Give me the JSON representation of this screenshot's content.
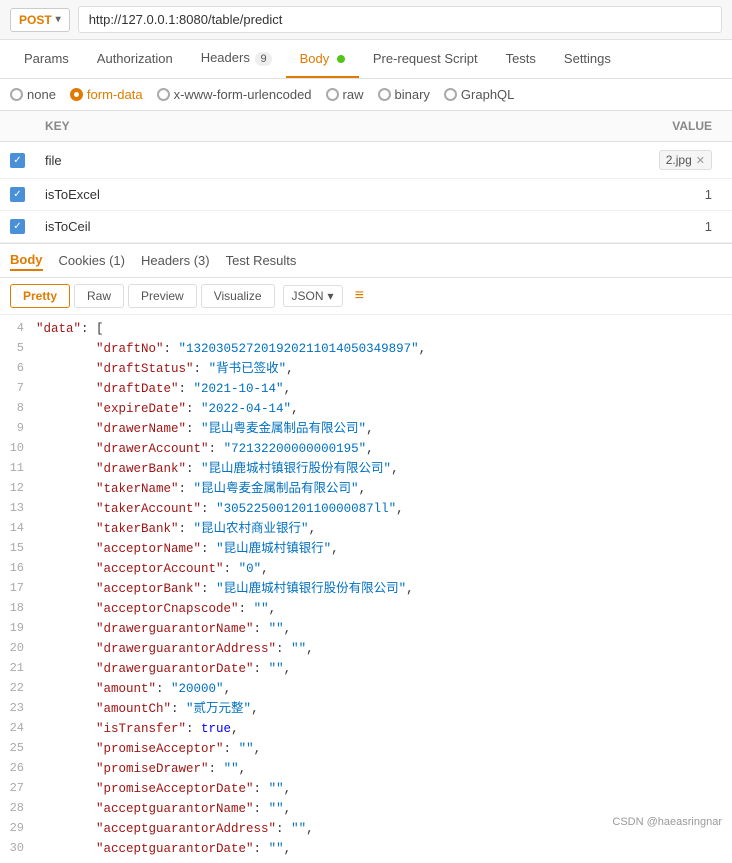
{
  "topbar": {
    "method": "POST",
    "url": "http://127.0.0.1:8080/table/predict"
  },
  "navtabs": {
    "items": [
      {
        "label": "Params",
        "active": false
      },
      {
        "label": "Authorization",
        "active": false
      },
      {
        "label": "Headers",
        "badge": "9",
        "active": false,
        "dot": false
      },
      {
        "label": "Body",
        "active": true,
        "dot": true
      },
      {
        "label": "Pre-request Script",
        "active": false
      },
      {
        "label": "Tests",
        "active": false
      },
      {
        "label": "Settings",
        "active": false
      }
    ]
  },
  "bodytypes": [
    {
      "label": "none",
      "selected": false
    },
    {
      "label": "form-data",
      "selected": true,
      "color": "#e07b00"
    },
    {
      "label": "x-www-form-urlencoded",
      "selected": false
    },
    {
      "label": "raw",
      "selected": false
    },
    {
      "label": "binary",
      "selected": false
    },
    {
      "label": "GraphQL",
      "selected": false
    }
  ],
  "table": {
    "columns": [
      "KEY",
      "VALUE"
    ],
    "rows": [
      {
        "checked": true,
        "key": "file",
        "value": "2.jpg",
        "isFile": true
      },
      {
        "checked": true,
        "key": "isToExcel",
        "value": "1",
        "isFile": false
      },
      {
        "checked": true,
        "key": "isToCeil",
        "value": "1",
        "isFile": false
      }
    ]
  },
  "responsetabs": [
    {
      "label": "Body",
      "active": true
    },
    {
      "label": "Cookies (1)",
      "active": false
    },
    {
      "label": "Headers (3)",
      "active": false
    },
    {
      "label": "Test Results",
      "active": false
    }
  ],
  "formattabs": [
    {
      "label": "Pretty",
      "active": true
    },
    {
      "label": "Raw",
      "active": false
    },
    {
      "label": "Preview",
      "active": false
    },
    {
      "label": "Visualize",
      "active": false
    }
  ],
  "jsonformat": "JSON",
  "codelines": [
    {
      "num": 4,
      "content": "    \"data\": [",
      "type": "mixed",
      "key": "data",
      "after": "["
    },
    {
      "num": 5,
      "content": "        \"draftNo\": \"132030527201920211014050349897\",",
      "key": "draftNo",
      "val": "132030527201920211014050349897"
    },
    {
      "num": 6,
      "content": "        \"draftStatus\": \"背书已签收\",",
      "key": "draftStatus",
      "val": "背书已签收"
    },
    {
      "num": 7,
      "content": "        \"draftDate\": \"2021-10-14\",",
      "key": "draftDate",
      "val": "2021-10-14"
    },
    {
      "num": 8,
      "content": "        \"expireDate\": \"2022-04-14\",",
      "key": "expireDate",
      "val": "2022-04-14"
    },
    {
      "num": 9,
      "content": "        \"drawerName\": \"昆山粤麦金属制品有限公司\",",
      "key": "drawerName",
      "val": "昆山粤麦金属制品有限公司"
    },
    {
      "num": 10,
      "content": "        \"drawerAccount\": \"72132200000000195\",",
      "key": "drawerAccount",
      "val": "72132200000000195"
    },
    {
      "num": 11,
      "content": "        \"drawerBank\": \"昆山鹿城村镇银行股份有限公司\",",
      "key": "drawerBank",
      "val": "昆山鹿城村镇银行股份有限公司"
    },
    {
      "num": 12,
      "content": "        \"takerName\": \"昆山粤麦金属制品有限公司\",",
      "key": "takerName",
      "val": "昆山粤麦金属制品有限公司"
    },
    {
      "num": 13,
      "content": "        \"takerAccount\": \"30522500120110000087ll\",",
      "key": "takerAccount",
      "val": "30522500120110000087ll"
    },
    {
      "num": 14,
      "content": "        \"takerBank\": \"昆山农村商业银行\",",
      "key": "takerBank",
      "val": "昆山农村商业银行"
    },
    {
      "num": 15,
      "content": "        \"acceptorName\": \"昆山鹿城村镇银行\",",
      "key": "acceptorName",
      "val": "昆山鹿城村镇银行"
    },
    {
      "num": 16,
      "content": "        \"acceptorAccount\": \"0\",",
      "key": "acceptorAccount",
      "val": "0"
    },
    {
      "num": 17,
      "content": "        \"acceptorBank\": \"昆山鹿城村镇银行股份有限公司\",",
      "key": "acceptorBank",
      "val": "昆山鹿城村镇银行股份有限公司"
    },
    {
      "num": 18,
      "content": "        \"acceptorCnapscode\": \"\",",
      "key": "acceptorCnapscode",
      "val": ""
    },
    {
      "num": 19,
      "content": "        \"drawerguarantorName\": \"\",",
      "key": "drawerguarantorName",
      "val": ""
    },
    {
      "num": 20,
      "content": "        \"drawerguarantorAddress\": \"\",",
      "key": "drawerguarantorAddress",
      "val": ""
    },
    {
      "num": 21,
      "content": "        \"drawerguarantorDate\": \"\",",
      "key": "drawerguarantorDate",
      "val": ""
    },
    {
      "num": 22,
      "content": "        \"amount\": \"20000\",",
      "key": "amount",
      "val": "20000"
    },
    {
      "num": 23,
      "content": "        \"amountCh\": \"贰万元整\",",
      "key": "amountCh",
      "val": "贰万元整"
    },
    {
      "num": 24,
      "content": "        \"isTransfer\": true,",
      "key": "isTransfer",
      "val": "true",
      "type": "bool"
    },
    {
      "num": 25,
      "content": "        \"promiseAcceptor\": \"\",",
      "key": "promiseAcceptor",
      "val": ""
    },
    {
      "num": 26,
      "content": "        \"promiseDrawer\": \"\",",
      "key": "promiseDrawer",
      "val": ""
    },
    {
      "num": 27,
      "content": "        \"promiseAcceptorDate\": \"\",",
      "key": "promiseAcceptorDate",
      "val": ""
    },
    {
      "num": 28,
      "content": "        \"acceptguarantorName\": \"\",",
      "key": "acceptguarantorName",
      "val": ""
    },
    {
      "num": 29,
      "content": "        \"acceptguarantorAddress\": \"\",",
      "key": "acceptguarantorAddress",
      "val": ""
    },
    {
      "num": 30,
      "content": "        \"acceptguarantorDate\": \"\",",
      "key": "acceptguarantorDate",
      "val": ""
    }
  ],
  "watermark": "CSDN @haeasringnar"
}
